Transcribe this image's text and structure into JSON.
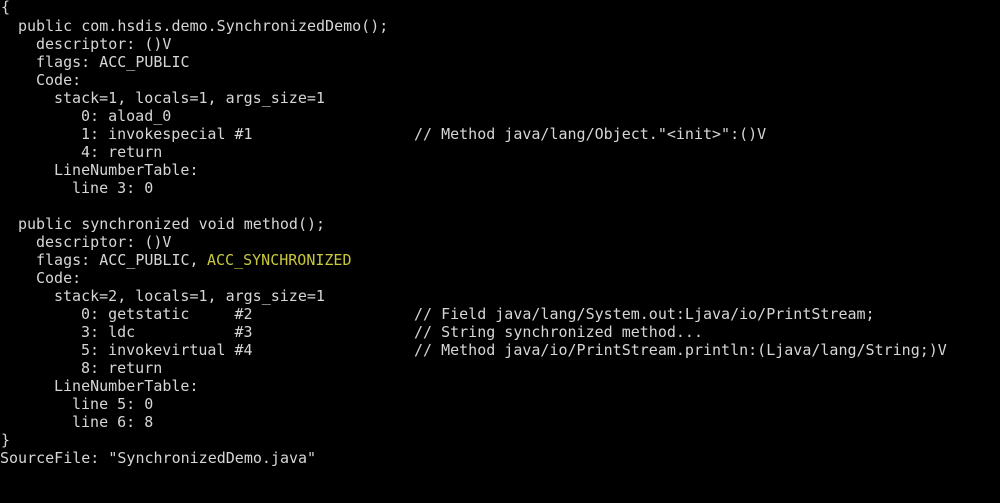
{
  "colors": {
    "background": "#000000",
    "text": "#d6d6d6",
    "highlight": "#c8c83c"
  },
  "console": {
    "open_brace": "{",
    "close_brace": "}",
    "source_file": "SourceFile: \"SynchronizedDemo.java\"",
    "constructor": {
      "signature": "public com.hsdis.demo.SynchronizedDemo();",
      "descriptor": "descriptor: ()V",
      "flags": "flags: ACC_PUBLIC",
      "code_label": "Code:",
      "stack": "stack=1, locals=1, args_size=1",
      "instructions": [
        {
          "text": "0: aload_0",
          "comment": ""
        },
        {
          "text": "1: invokespecial #1",
          "comment": "// Method java/lang/Object.\"<init>\":()V"
        },
        {
          "text": "4: return",
          "comment": ""
        }
      ],
      "line_number_table_label": "LineNumberTable:",
      "line_numbers": [
        "line 3: 0"
      ]
    },
    "method": {
      "signature": "public synchronized void method();",
      "descriptor": "descriptor: ()V",
      "flags_prefix": "flags: ACC_PUBLIC,",
      "flags_highlight": "ACC_SYNCHRONIZED",
      "code_label": "Code:",
      "stack": "stack=2, locals=1, args_size=1",
      "instructions": [
        {
          "text": "0: getstatic     #2",
          "comment": "// Field java/lang/System.out:Ljava/io/PrintStream;"
        },
        {
          "text": "3: ldc           #3",
          "comment": "// String synchronized method..."
        },
        {
          "text": "5: invokevirtual #4",
          "comment": "// Method java/io/PrintStream.println:(Ljava/lang/String;)V"
        },
        {
          "text": "8: return",
          "comment": ""
        }
      ],
      "line_number_table_label": "LineNumberTable:",
      "line_numbers": [
        "line 5: 0",
        "line 6: 8"
      ]
    }
  }
}
